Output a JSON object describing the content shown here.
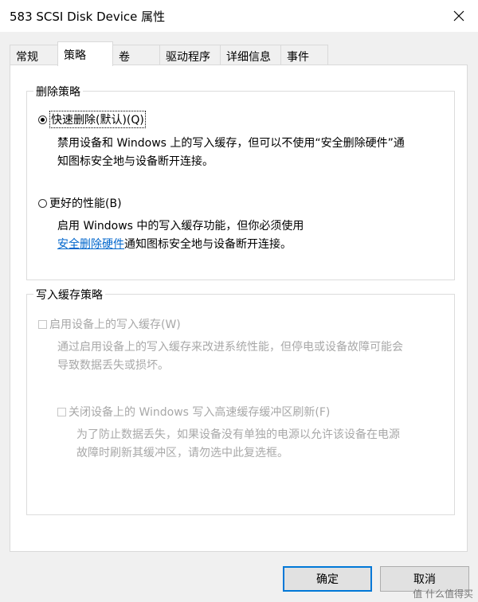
{
  "window": {
    "title": "583  SCSI Disk Device 属性"
  },
  "tabs": [
    {
      "label": "常规"
    },
    {
      "label": "策略"
    },
    {
      "label": "卷"
    },
    {
      "label": "驱动程序"
    },
    {
      "label": "详细信息"
    },
    {
      "label": "事件"
    }
  ],
  "removal_policy": {
    "title": "删除策略",
    "quick_removal": {
      "label": "快速删除(默认)(Q)",
      "selected": true,
      "desc_line1": "禁用设备和 Windows 上的写入缓存，但可以不使用“安全删除硬件”通",
      "desc_line2": "知图标安全地与设备断开连接。"
    },
    "better_performance": {
      "label": "更好的性能(B)",
      "selected": false,
      "desc_line1": "启用 Windows 中的写入缓存功能，但你必须使用",
      "desc_link": "安全删除硬件",
      "desc_line2_rest": "通知图标安全地与设备断开连接。"
    }
  },
  "write_cache_policy": {
    "title": "写入缓存策略",
    "enable_cache": {
      "label": "启用设备上的写入缓存(W)",
      "checked": false,
      "desc_line1": "通过启用设备上的写入缓存来改进系统性能，但停电或设备故障可能会",
      "desc_line2": "导致数据丢失或损坏。"
    },
    "disable_flush": {
      "label": "关闭设备上的 Windows 写入高速缓存缓冲区刷新(F)",
      "checked": false,
      "desc_line1": "为了防止数据丢失，如果设备没有单独的电源以允许该设备在电源",
      "desc_line2": "故障时刷新其缓冲区，请勿选中此复选框。"
    }
  },
  "buttons": {
    "ok": "确定",
    "cancel": "取消"
  },
  "watermark": "值 什么值得买"
}
